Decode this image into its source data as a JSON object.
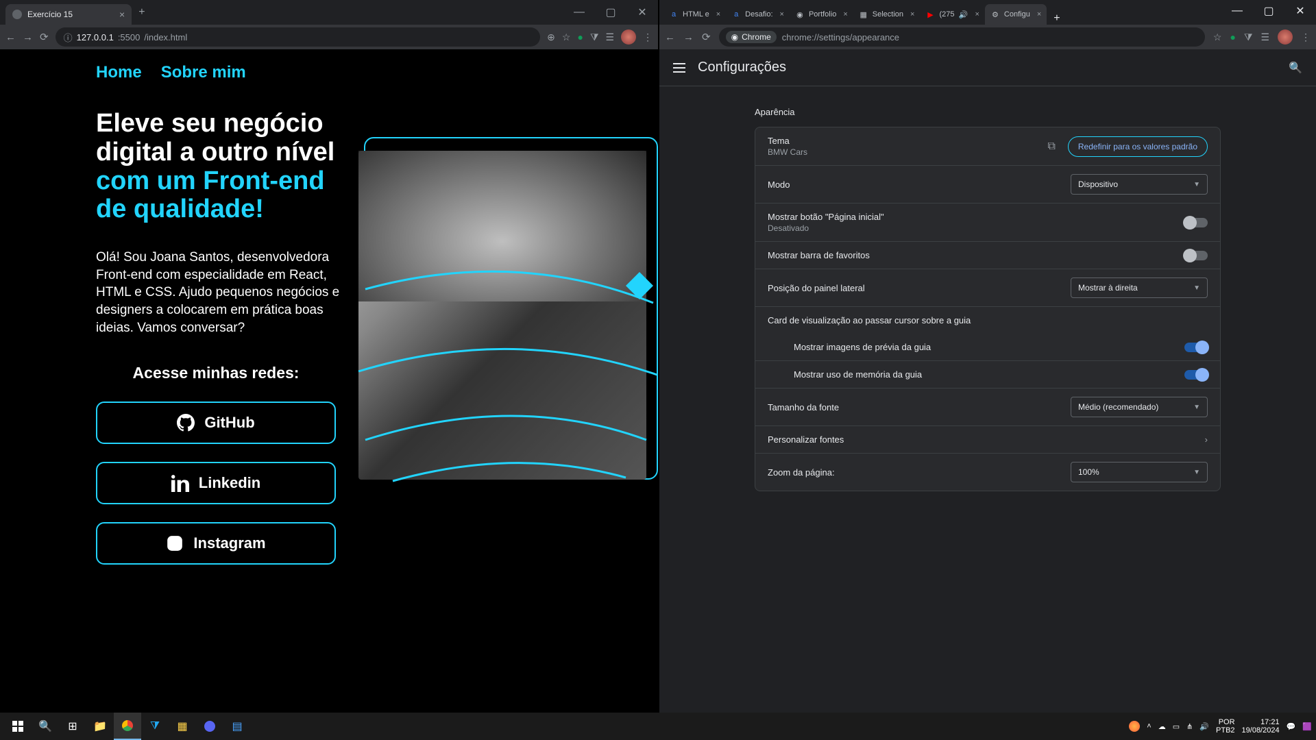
{
  "left_window": {
    "tab_title": "Exercício 15",
    "url_host": "127.0.0.1",
    "url_port": ":5500",
    "url_path": "/index.html",
    "nav": {
      "home": "Home",
      "about": "Sobre mim"
    },
    "headline_white": "Eleve seu negócio digital a outro nível",
    "headline_accent": "com um Front-end de qualidade!",
    "description": "Olá! Sou Joana Santos, desenvolvedora Front-end com especialidade em React, HTML e CSS. Ajudo pequenos negócios e designers a colocarem em prática boas ideias. Vamos conversar?",
    "subtitle": "Acesse minhas redes:",
    "buttons": {
      "github": "GitHub",
      "linkedin": "Linkedin",
      "instagram": "Instagram"
    }
  },
  "right_window": {
    "tabs": [
      {
        "title": "HTML e"
      },
      {
        "title": "Desafio:"
      },
      {
        "title": "Portfolio"
      },
      {
        "title": "Selection"
      },
      {
        "title": "(275"
      },
      {
        "title": "Configu",
        "active": true
      }
    ],
    "address": {
      "chip": "Chrome",
      "url": "chrome://settings/appearance"
    },
    "settings_title": "Configurações",
    "section_title": "Aparência",
    "rows": {
      "theme_label": "Tema",
      "theme_value": "BMW Cars",
      "reset_btn": "Redefinir para os valores padrão",
      "mode_label": "Modo",
      "mode_value": "Dispositivo",
      "home_btn_label": "Mostrar botão \"Página inicial\"",
      "home_btn_value": "Desativado",
      "bookmarks_label": "Mostrar barra de favoritos",
      "sidepanel_label": "Posição do painel lateral",
      "sidepanel_value": "Mostrar à direita",
      "hovercard_header": "Card de visualização ao passar cursor sobre a guia",
      "preview_img_label": "Mostrar imagens de prévia da guia",
      "memory_label": "Mostrar uso de memória da guia",
      "fontsize_label": "Tamanho da fonte",
      "fontsize_value": "Médio (recomendado)",
      "custom_fonts_label": "Personalizar fontes",
      "zoom_label": "Zoom da página:",
      "zoom_value": "100%"
    }
  },
  "taskbar": {
    "lang1": "POR",
    "lang2": "PTB2",
    "time": "17:21",
    "date": "19/08/2024"
  }
}
